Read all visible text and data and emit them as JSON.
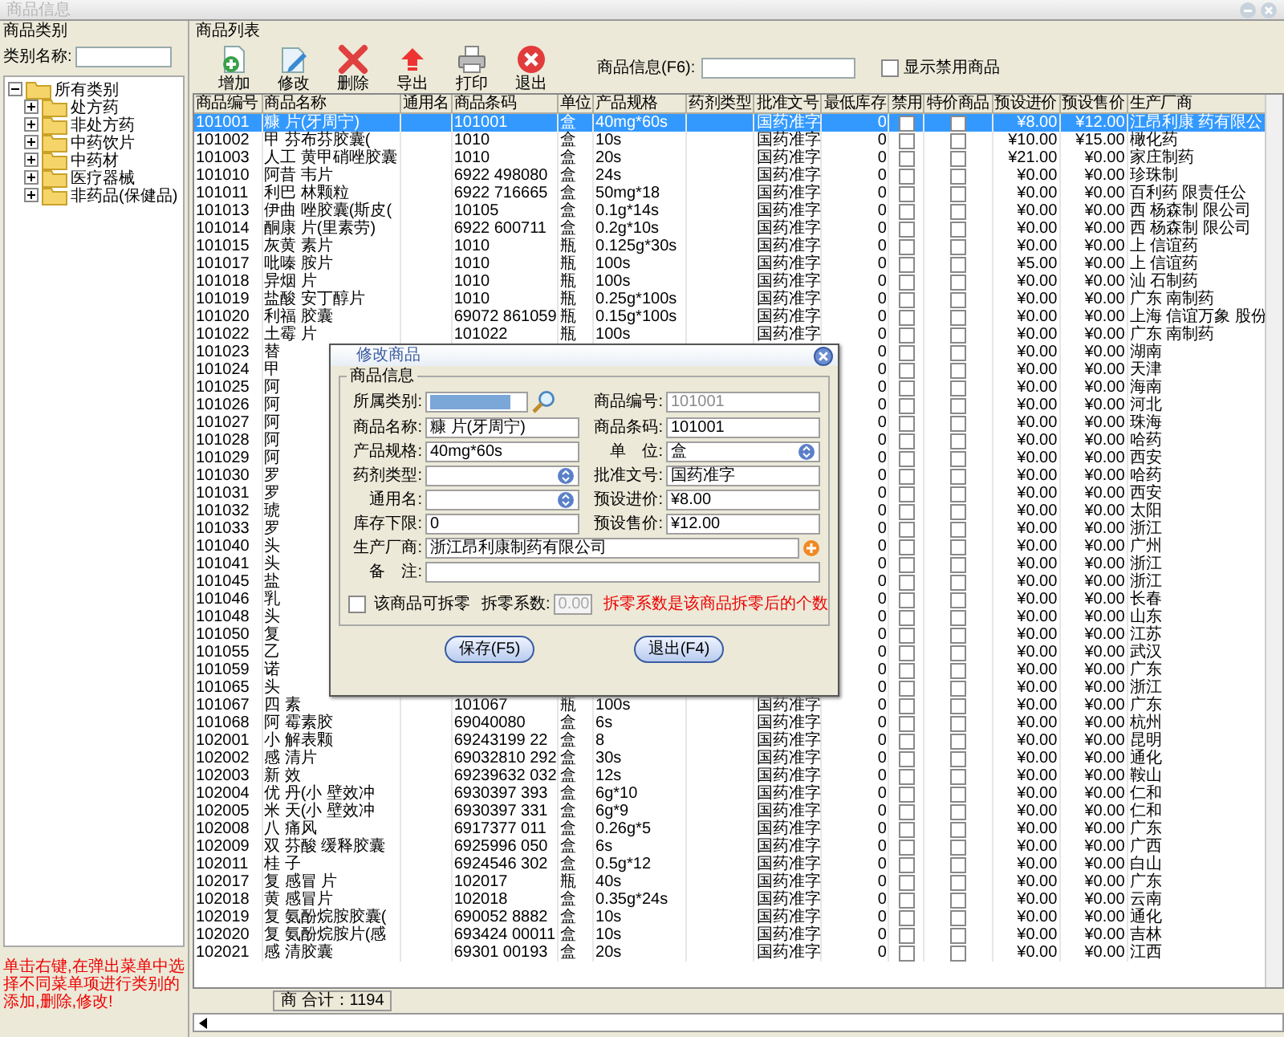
{
  "window": {
    "title": "商品信息"
  },
  "category_panel": {
    "title": "商品类别",
    "search_label": "类别名称:",
    "tree": [
      {
        "label": "所有类别",
        "expanded": true,
        "children": [
          {
            "label": "处方药",
            "expanded": false
          },
          {
            "label": "非处方药",
            "expanded": false
          },
          {
            "label": "中药饮片",
            "expanded": false
          },
          {
            "label": "中药材",
            "expanded": false
          },
          {
            "label": "医疗器械",
            "expanded": false
          },
          {
            "label": "非药品(保健品)",
            "expanded": false
          }
        ]
      }
    ],
    "hint": "单击右键,在弹出菜单中选择不同菜单项进行类别的添加,删除,修改!"
  },
  "list_panel": {
    "title": "商品列表",
    "toolbar": [
      {
        "kind": "add",
        "label": "增加"
      },
      {
        "kind": "edit",
        "label": "修改"
      },
      {
        "kind": "delete",
        "label": "删除"
      },
      {
        "kind": "export",
        "label": "导出"
      },
      {
        "kind": "print",
        "label": "打印"
      },
      {
        "kind": "exit",
        "label": "退出"
      }
    ],
    "search_label": "商品信息(F6):",
    "show_disabled": {
      "label": "显示禁用商品",
      "checked": false
    }
  },
  "table": {
    "columns": [
      "商品编号",
      "商品名称",
      "通用名",
      "商品条码",
      "单位",
      "产品规格",
      "药剂类型",
      "批准文号",
      "最低库存",
      "禁用",
      "特价商品",
      "预设进价",
      "预设售价",
      "生产厂商"
    ],
    "rows": [
      {
        "code": "101001",
        "name": "糠 片(牙周宁)",
        "barcode": "101001",
        "unit": "盒",
        "spec": "40mg*60s",
        "approval": "国药准字",
        "min": "0",
        "disabled": false,
        "special": false,
        "cost": "¥8.00",
        "price": "¥12.00",
        "maker": "江昂利康 药有限公",
        "selected": true
      },
      {
        "code": "101002",
        "name": "甲 芬布芬胶囊(",
        "barcode": "1010",
        "unit": "盒",
        "spec": "10s",
        "approval": "国药准字",
        "min": "0",
        "disabled": false,
        "special": false,
        "cost": "¥10.00",
        "price": "¥15.00",
        "maker": "橄化药",
        "selected": false
      },
      {
        "code": "101003",
        "name": "人工 黄甲硝唑胶囊",
        "barcode": "1010",
        "unit": "盒",
        "spec": "20s",
        "approval": "国药准字",
        "min": "0",
        "disabled": false,
        "special": false,
        "cost": "¥21.00",
        "price": "¥0.00",
        "maker": "家庄制药",
        "selected": false
      },
      {
        "code": "101010",
        "name": "阿昔 韦片",
        "barcode": "6922 498080",
        "unit": "盒",
        "spec": "24s",
        "approval": "国药准字",
        "min": "0",
        "disabled": false,
        "special": false,
        "cost": "¥0.00",
        "price": "¥0.00",
        "maker": "珍珠制",
        "selected": false
      },
      {
        "code": "101011",
        "name": "利巴 林颗粒",
        "barcode": "6922 716665",
        "unit": "盒",
        "spec": "50mg*18",
        "approval": "国药准字",
        "min": "0",
        "disabled": false,
        "special": false,
        "cost": "¥0.00",
        "price": "¥0.00",
        "maker": "百利药 限责任公",
        "selected": false
      },
      {
        "code": "101013",
        "name": "伊曲 唑胶囊(斯皮(",
        "barcode": "10105",
        "unit": "盒",
        "spec": "0.1g*14s",
        "approval": "国药准字",
        "min": "0",
        "disabled": false,
        "special": false,
        "cost": "¥0.00",
        "price": "¥0.00",
        "maker": "西 杨森制 限公司",
        "selected": false
      },
      {
        "code": "101014",
        "name": "酮康 片(里素劳)",
        "barcode": "6922 600711",
        "unit": "盒",
        "spec": "0.2g*10s",
        "approval": "国药准字",
        "min": "0",
        "disabled": false,
        "special": false,
        "cost": "¥0.00",
        "price": "¥0.00",
        "maker": "西 杨森制 限公司",
        "selected": false
      },
      {
        "code": "101015",
        "name": "灰黄 素片",
        "barcode": "1010",
        "unit": "瓶",
        "spec": "0.125g*30s",
        "approval": "国药准字",
        "min": "0",
        "disabled": false,
        "special": false,
        "cost": "¥0.00",
        "price": "¥0.00",
        "maker": "上 信谊药",
        "selected": false
      },
      {
        "code": "101017",
        "name": "吡嗪 胺片",
        "barcode": "1010",
        "unit": "瓶",
        "spec": "100s",
        "approval": "国药准字",
        "min": "0",
        "disabled": false,
        "special": false,
        "cost": "¥5.00",
        "price": "¥0.00",
        "maker": "上 信谊药",
        "selected": false
      },
      {
        "code": "101018",
        "name": "异烟 片",
        "barcode": "1010",
        "unit": "瓶",
        "spec": "100s",
        "approval": "国药准字",
        "min": "0",
        "disabled": false,
        "special": false,
        "cost": "¥0.00",
        "price": "¥0.00",
        "maker": "汕 石制药",
        "selected": false
      },
      {
        "code": "101019",
        "name": "盐酸 安丁醇片",
        "barcode": "1010",
        "unit": "瓶",
        "spec": "0.25g*100s",
        "approval": "国药准字",
        "min": "0",
        "disabled": false,
        "special": false,
        "cost": "¥0.00",
        "price": "¥0.00",
        "maker": "广东 南制药",
        "selected": false
      },
      {
        "code": "101020",
        "name": "利福 胶囊",
        "barcode": "69072 861059",
        "unit": "瓶",
        "spec": "0.15g*100s",
        "approval": "国药准字",
        "min": "0",
        "disabled": false,
        "special": false,
        "cost": "¥0.00",
        "price": "¥0.00",
        "maker": "上海 信谊万象 股份",
        "selected": false
      },
      {
        "code": "101022",
        "name": "土霉 片",
        "barcode": "101022",
        "unit": "瓶",
        "spec": "100s",
        "approval": "国药准字",
        "min": "0",
        "disabled": false,
        "special": false,
        "cost": "¥0.00",
        "price": "¥0.00",
        "maker": "广东 南制药",
        "selected": false
      },
      {
        "code": "101023",
        "name": "替",
        "min": "0",
        "disabled": false,
        "special": false,
        "cost": "¥0.00",
        "price": "¥0.00",
        "maker": "湖南",
        "selected": false
      },
      {
        "code": "101024",
        "name": "甲",
        "min": "0",
        "disabled": false,
        "special": false,
        "cost": "¥0.00",
        "price": "¥0.00",
        "maker": "天津",
        "selected": false
      },
      {
        "code": "101025",
        "name": "阿",
        "min": "0",
        "disabled": false,
        "special": false,
        "cost": "¥0.00",
        "price": "¥0.00",
        "maker": "海南",
        "selected": false
      },
      {
        "code": "101026",
        "name": "阿",
        "min": "0",
        "disabled": false,
        "special": false,
        "cost": "¥0.00",
        "price": "¥0.00",
        "maker": "河北",
        "selected": false
      },
      {
        "code": "101027",
        "name": "阿",
        "min": "0",
        "disabled": false,
        "special": false,
        "cost": "¥0.00",
        "price": "¥0.00",
        "maker": "珠海",
        "selected": false
      },
      {
        "code": "101028",
        "name": "阿",
        "min": "0",
        "disabled": false,
        "special": false,
        "cost": "¥0.00",
        "price": "¥0.00",
        "maker": "哈药",
        "selected": false
      },
      {
        "code": "101029",
        "name": "阿",
        "min": "0",
        "disabled": false,
        "special": false,
        "cost": "¥0.00",
        "price": "¥0.00",
        "maker": "西安",
        "selected": false
      },
      {
        "code": "101030",
        "name": "罗",
        "min": "0",
        "disabled": false,
        "special": false,
        "cost": "¥0.00",
        "price": "¥0.00",
        "maker": "哈药",
        "selected": false
      },
      {
        "code": "101031",
        "name": "罗",
        "min": "0",
        "disabled": false,
        "special": false,
        "cost": "¥0.00",
        "price": "¥0.00",
        "maker": "西安",
        "selected": false
      },
      {
        "code": "101032",
        "name": "琥",
        "min": "0",
        "disabled": false,
        "special": false,
        "cost": "¥0.00",
        "price": "¥0.00",
        "maker": "太阳",
        "selected": false
      },
      {
        "code": "101033",
        "name": "罗",
        "min": "0",
        "disabled": false,
        "special": false,
        "cost": "¥0.00",
        "price": "¥0.00",
        "maker": "浙江",
        "selected": false
      },
      {
        "code": "101040",
        "name": "头",
        "min": "0",
        "disabled": false,
        "special": false,
        "cost": "¥0.00",
        "price": "¥0.00",
        "maker": "广州",
        "selected": false
      },
      {
        "code": "101041",
        "name": "头",
        "min": "0",
        "disabled": false,
        "special": false,
        "cost": "¥0.00",
        "price": "¥0.00",
        "maker": "浙江",
        "selected": false
      },
      {
        "code": "101045",
        "name": "盐",
        "min": "0",
        "disabled": false,
        "special": false,
        "cost": "¥0.00",
        "price": "¥0.00",
        "maker": "浙江",
        "selected": false
      },
      {
        "code": "101046",
        "name": "乳",
        "min": "0",
        "disabled": false,
        "special": false,
        "cost": "¥0.00",
        "price": "¥0.00",
        "maker": "长春",
        "selected": false
      },
      {
        "code": "101048",
        "name": "头",
        "min": "0",
        "disabled": false,
        "special": false,
        "cost": "¥0.00",
        "price": "¥0.00",
        "maker": "山东",
        "selected": false
      },
      {
        "code": "101050",
        "name": "复",
        "min": "0",
        "disabled": false,
        "special": false,
        "cost": "¥0.00",
        "price": "¥0.00",
        "maker": "江苏",
        "selected": false
      },
      {
        "code": "101055",
        "name": "乙",
        "min": "0",
        "disabled": false,
        "special": false,
        "cost": "¥0.00",
        "price": "¥0.00",
        "maker": "武汉",
        "selected": false
      },
      {
        "code": "101059",
        "name": "诺",
        "min": "0",
        "disabled": false,
        "special": false,
        "cost": "¥0.00",
        "price": "¥0.00",
        "maker": "广东",
        "selected": false
      },
      {
        "code": "101065",
        "name": "头",
        "min": "0",
        "disabled": false,
        "special": false,
        "cost": "¥0.00",
        "price": "¥0.00",
        "maker": "浙江",
        "selected": false
      },
      {
        "code": "101067",
        "name": "四 素",
        "barcode": "101067",
        "unit": "瓶",
        "spec": "100s",
        "approval": "国药准字",
        "min": "0",
        "disabled": false,
        "special": false,
        "cost": "¥0.00",
        "price": "¥0.00",
        "maker": "广东",
        "selected": false
      },
      {
        "code": "101068",
        "name": "阿 霉素胶",
        "barcode": "69040080",
        "unit": "盒",
        "spec": "6s",
        "approval": "国药准字",
        "min": "0",
        "disabled": false,
        "special": false,
        "cost": "¥0.00",
        "price": "¥0.00",
        "maker": "杭州",
        "selected": false
      },
      {
        "code": "102001",
        "name": "小 解表颗",
        "barcode": "69243199 22",
        "unit": "盒",
        "spec": "8",
        "approval": "国药准字",
        "min": "0",
        "disabled": false,
        "special": false,
        "cost": "¥0.00",
        "price": "¥0.00",
        "maker": "昆明",
        "selected": false
      },
      {
        "code": "102002",
        "name": "感 清片",
        "barcode": "69032810 292",
        "unit": "盒",
        "spec": "30s",
        "approval": "国药准字",
        "min": "0",
        "disabled": false,
        "special": false,
        "cost": "¥0.00",
        "price": "¥0.00",
        "maker": "通化",
        "selected": false
      },
      {
        "code": "102003",
        "name": "新 效",
        "barcode": "69239632 032",
        "unit": "盒",
        "spec": "12s",
        "approval": "国药准字",
        "min": "0",
        "disabled": false,
        "special": false,
        "cost": "¥0.00",
        "price": "¥0.00",
        "maker": "鞍山",
        "selected": false
      },
      {
        "code": "102004",
        "name": "优 丹(小 壁效冲",
        "barcode": "6930397 393",
        "unit": "盒",
        "spec": "6g*10",
        "approval": "国药准字",
        "min": "0",
        "disabled": false,
        "special": false,
        "cost": "¥0.00",
        "price": "¥0.00",
        "maker": "仁和",
        "selected": false
      },
      {
        "code": "102005",
        "name": "米 天(小 壁效冲",
        "barcode": "6930397 331",
        "unit": "盒",
        "spec": "6g*9",
        "approval": "国药准字",
        "min": "0",
        "disabled": false,
        "special": false,
        "cost": "¥0.00",
        "price": "¥0.00",
        "maker": "仁和",
        "selected": false
      },
      {
        "code": "102008",
        "name": "八 痛风",
        "barcode": "6917377 011",
        "unit": "盒",
        "spec": "0.26g*5",
        "approval": "国药准字",
        "min": "0",
        "disabled": false,
        "special": false,
        "cost": "¥0.00",
        "price": "¥0.00",
        "maker": "广东",
        "selected": false
      },
      {
        "code": "102009",
        "name": "双 芬酸 缓释胶囊",
        "barcode": "6925996 050",
        "unit": "盒",
        "spec": "6s",
        "approval": "国药准字",
        "min": "0",
        "disabled": false,
        "special": false,
        "cost": "¥0.00",
        "price": "¥0.00",
        "maker": "广西",
        "selected": false
      },
      {
        "code": "102011",
        "name": "桂 子",
        "barcode": "6924546 302",
        "unit": "盒",
        "spec": "0.5g*12",
        "approval": "国药准字",
        "min": "0",
        "disabled": false,
        "special": false,
        "cost": "¥0.00",
        "price": "¥0.00",
        "maker": "白山",
        "selected": false
      },
      {
        "code": "102017",
        "name": "复 感冒 片",
        "barcode": "102017",
        "unit": "瓶",
        "spec": "40s",
        "approval": "国药准字",
        "min": "0",
        "disabled": false,
        "special": false,
        "cost": "¥0.00",
        "price": "¥0.00",
        "maker": "广东",
        "selected": false
      },
      {
        "code": "102018",
        "name": "黄 感冒片",
        "barcode": "102018",
        "unit": "盒",
        "spec": "0.35g*24s",
        "approval": "国药准字",
        "min": "0",
        "disabled": false,
        "special": false,
        "cost": "¥0.00",
        "price": "¥0.00",
        "maker": "云南",
        "selected": false
      },
      {
        "code": "102019",
        "name": "复 氨酚烷胺胶囊(",
        "barcode": "690052 8882",
        "unit": "盒",
        "spec": "10s",
        "approval": "国药准字",
        "min": "0",
        "disabled": false,
        "special": false,
        "cost": "¥0.00",
        "price": "¥0.00",
        "maker": "通化",
        "selected": false
      },
      {
        "code": "102020",
        "name": "复 氨酚烷胺片(感",
        "barcode": "693424 00011",
        "unit": "盒",
        "spec": "10s",
        "approval": "国药准字",
        "min": "0",
        "disabled": false,
        "special": false,
        "cost": "¥0.00",
        "price": "¥0.00",
        "maker": "吉林",
        "selected": false
      },
      {
        "code": "102021",
        "name": "感 清胶囊",
        "barcode": "69301 00193",
        "unit": "盒",
        "spec": "20s",
        "approval": "国药准字",
        "min": "0",
        "disabled": false,
        "special": false,
        "cost": "¥0.00",
        "price": "¥0.00",
        "maker": "江西",
        "selected": false
      }
    ],
    "total": "商 合计：1194"
  },
  "dialog": {
    "title": "修改商品",
    "group": "商品信息",
    "fields": [
      {
        "kind": "picker",
        "label": "所属类别:"
      },
      {
        "kind": "readonly",
        "label": "商品编号:",
        "value": "101001"
      },
      {
        "kind": "text",
        "label": "商品名称:",
        "value": "糠 片(牙周宁)"
      },
      {
        "kind": "text",
        "label": "商品条码:",
        "value": "101001"
      },
      {
        "kind": "text",
        "label": "产品规格:",
        "value": "40mg*60s"
      },
      {
        "kind": "select",
        "label": "单　位:",
        "value": "盒"
      },
      {
        "kind": "select",
        "label": "药剂类型:"
      },
      {
        "kind": "text",
        "label": "批准文号:",
        "value": "国药准字"
      },
      {
        "kind": "select",
        "label": "通用名:"
      },
      {
        "kind": "text",
        "label": "预设进价:",
        "value": "¥8.00"
      },
      {
        "kind": "text",
        "label": "库存下限:",
        "value": "0"
      },
      {
        "kind": "text",
        "label": "预设售价:",
        "value": "¥12.00"
      }
    ],
    "maker_label": "生产厂商:",
    "maker": "浙江昂利康制药有限公司",
    "note_label": "备　注:",
    "split": {
      "label": "该商品可拆零",
      "checked": false
    },
    "ratio_label": "拆零系数:",
    "ratio": "0.00",
    "ratio_hint": "拆零系数是该商品拆零后的个数",
    "buttons": [
      "保存(F5)",
      "退出(F4)"
    ]
  }
}
